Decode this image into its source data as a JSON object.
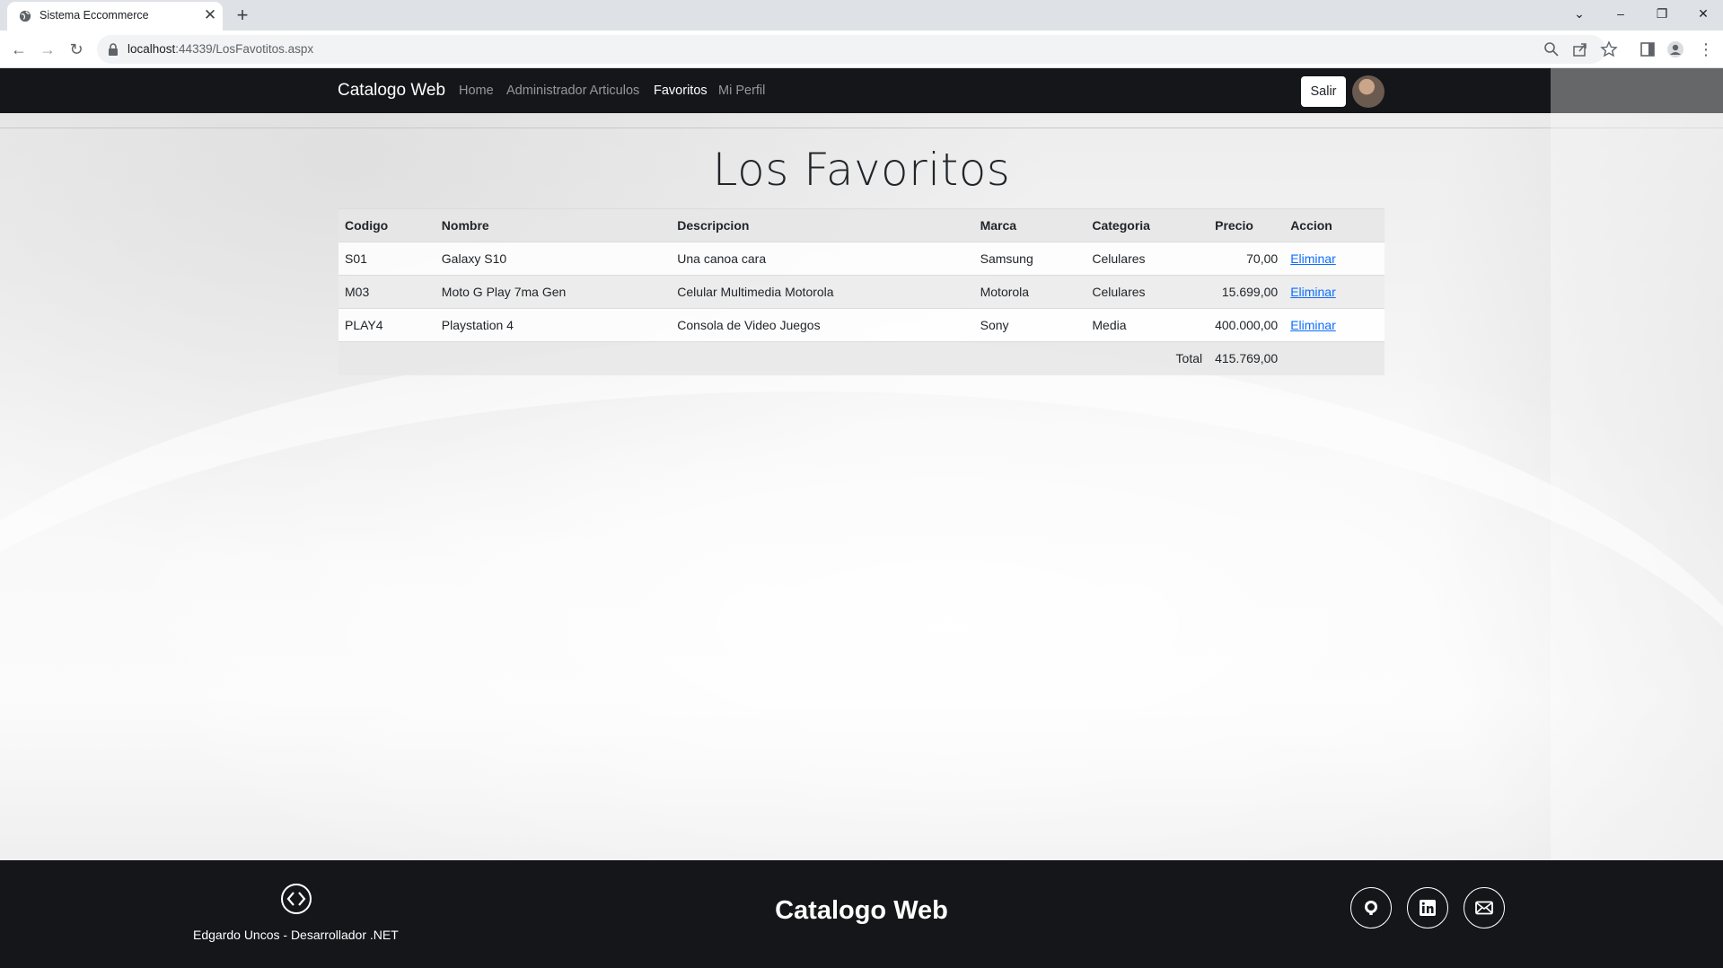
{
  "browser": {
    "tab_title": "Sistema Eccommerce",
    "url_host": "localhost",
    "url_path": ":44339/LosFavotitos.aspx"
  },
  "navbar": {
    "brand": "Catalogo Web",
    "links": [
      "Home",
      "Administrador Articulos",
      "Favoritos",
      "Mi Perfil"
    ],
    "logout_label": "Salir"
  },
  "main": {
    "title": "Los Favoritos",
    "table": {
      "headers": [
        "Codigo",
        "Nombre",
        "Descripcion",
        "Marca",
        "Categoria",
        "Precio",
        "Accion"
      ],
      "rows": [
        {
          "codigo": "S01",
          "nombre": "Galaxy S10",
          "descripcion": "Una canoa cara",
          "marca": "Samsung",
          "categoria": "Celulares",
          "precio": "70,00",
          "accion": "Eliminar"
        },
        {
          "codigo": "M03",
          "nombre": "Moto G Play 7ma Gen",
          "descripcion": "Celular Multimedia Motorola",
          "marca": "Motorola",
          "categoria": "Celulares",
          "precio": "15.699,00",
          "accion": "Eliminar"
        },
        {
          "codigo": "PLAY4",
          "nombre": "Playstation 4",
          "descripcion": "Consola de Video Juegos",
          "marca": "Sony",
          "categoria": "Media",
          "precio": "400.000,00",
          "accion": "Eliminar"
        }
      ],
      "total_label": "Total",
      "total_value": "415.769,00"
    }
  },
  "footer": {
    "author": "Edgardo Uncos - Desarrollador .NET",
    "brand": "Catalogo Web",
    "social_icons": [
      "github-icon",
      "linkedin-icon",
      "mail-icon"
    ]
  },
  "colors": {
    "navbar_bg": "#141619",
    "link": "#0d6efd"
  }
}
